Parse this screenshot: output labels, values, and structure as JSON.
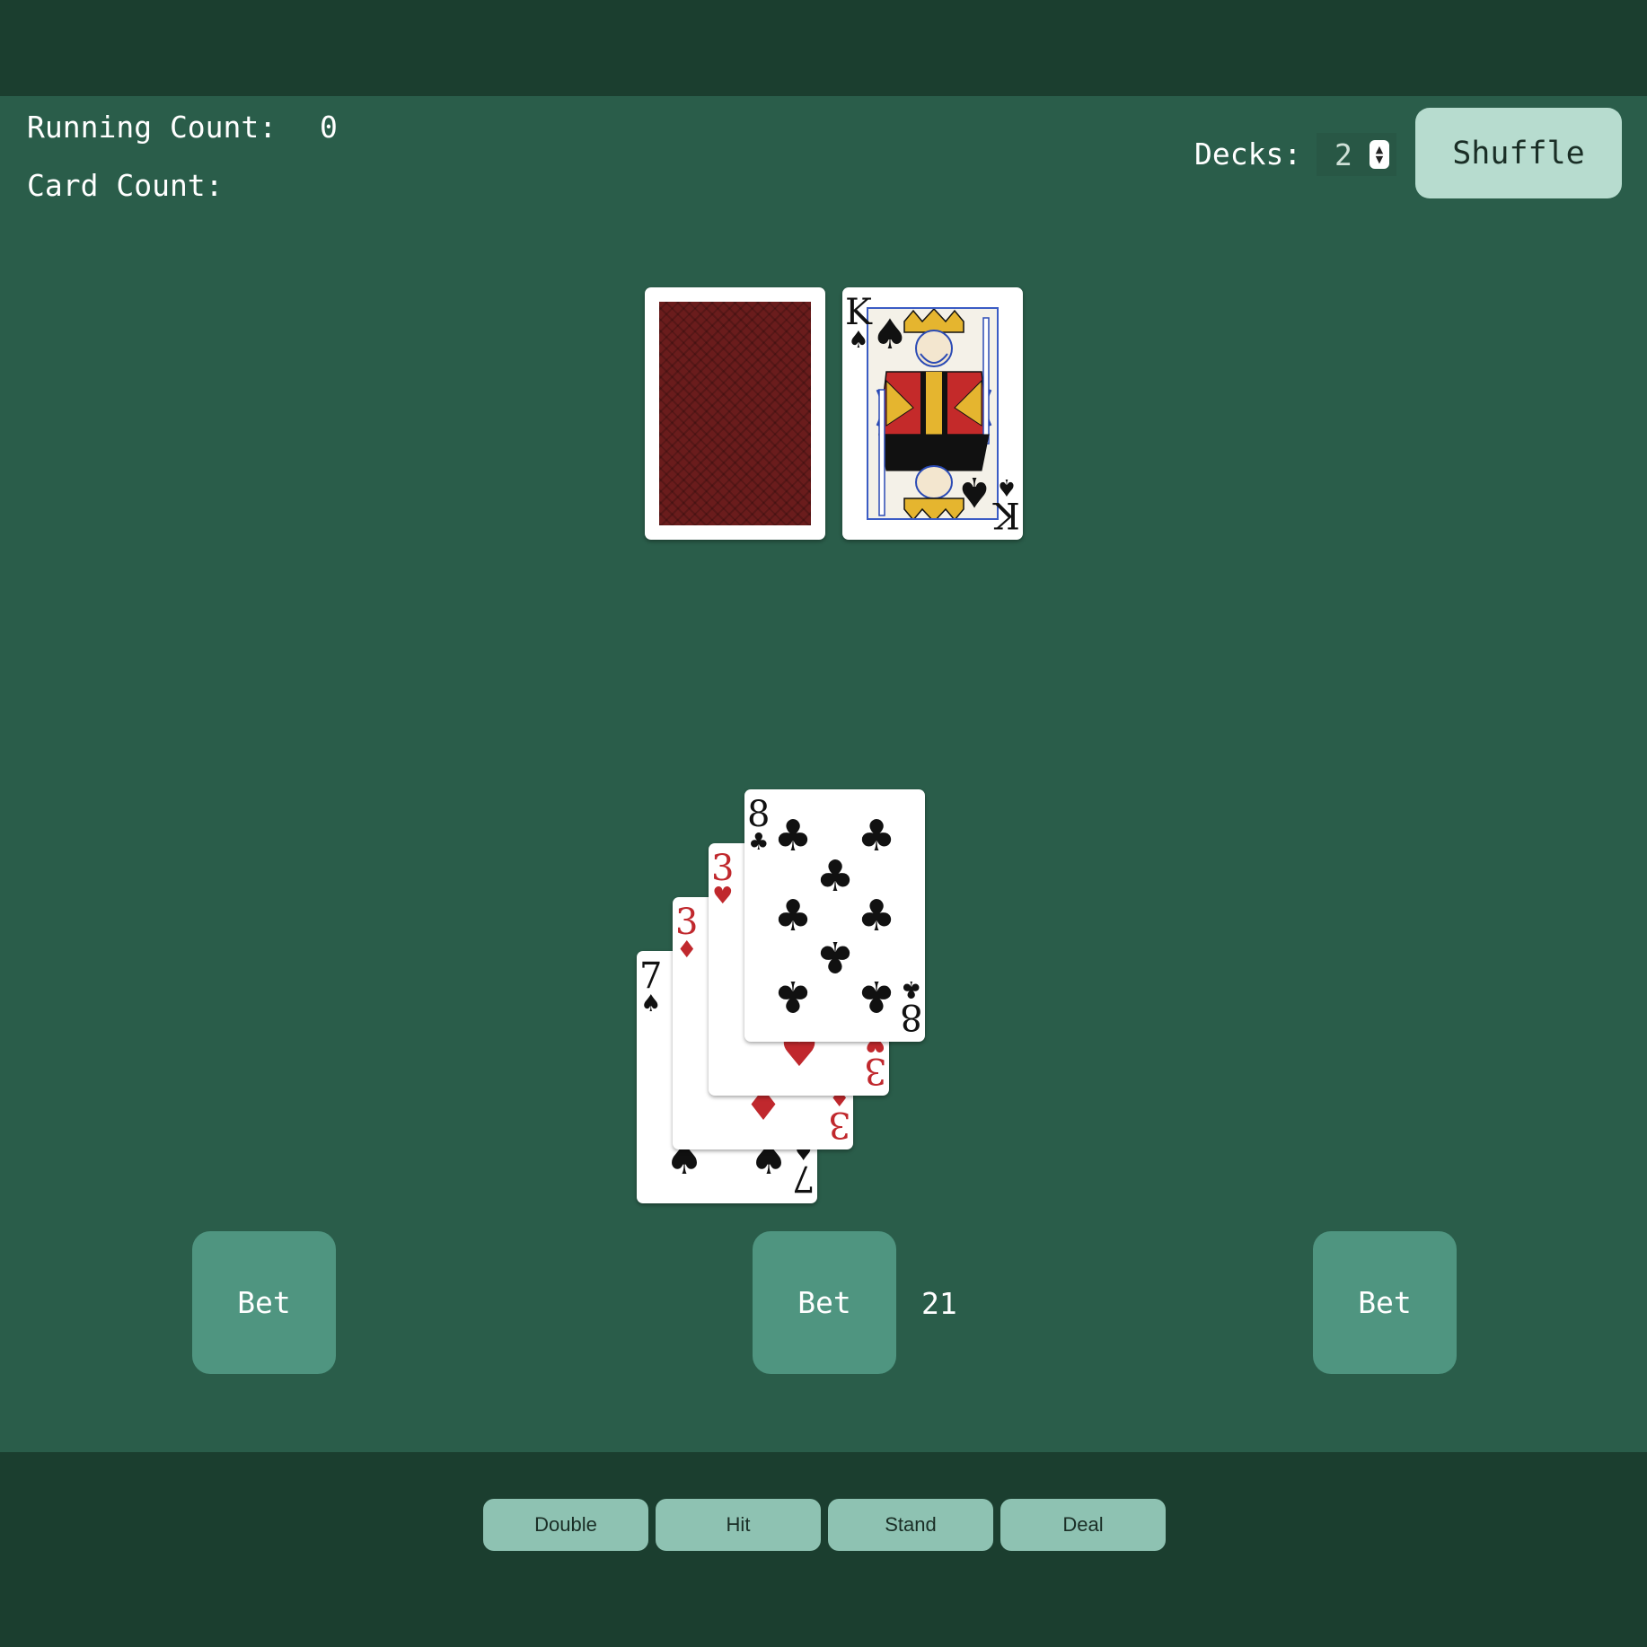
{
  "stats": {
    "running_count_label": "Running Count:",
    "running_count_value": "0",
    "card_count_label": "Card Count:"
  },
  "controls": {
    "decks_label": "Decks:",
    "decks_value": "2",
    "shuffle_label": "Shuffle"
  },
  "dealer": {
    "cards": [
      {
        "face_down": true
      },
      {
        "rank": "K",
        "suit": "♠",
        "suit_name": "spades",
        "color": "black"
      }
    ]
  },
  "player": {
    "cards": [
      {
        "rank": "7",
        "suit": "♠",
        "suit_name": "spades",
        "color": "black"
      },
      {
        "rank": "3",
        "suit": "♦",
        "suit_name": "diamonds",
        "color": "red"
      },
      {
        "rank": "3",
        "suit": "♥",
        "suit_name": "hearts",
        "color": "red"
      },
      {
        "rank": "8",
        "suit": "♣",
        "suit_name": "clubs",
        "color": "black"
      }
    ],
    "hand_value": "21"
  },
  "bets": [
    {
      "label": "Bet"
    },
    {
      "label": "Bet"
    },
    {
      "label": "Bet"
    }
  ],
  "actions": {
    "double": "Double",
    "hit": "Hit",
    "stand": "Stand",
    "deal": "Deal"
  },
  "colors": {
    "table": "#2a5d4a",
    "bar": "#1b3e2f",
    "bet_button": "#4f9580",
    "action_button": "#8ec2b2",
    "shuffle_button": "#b7dccf",
    "card_back": "#6a1c1c"
  }
}
